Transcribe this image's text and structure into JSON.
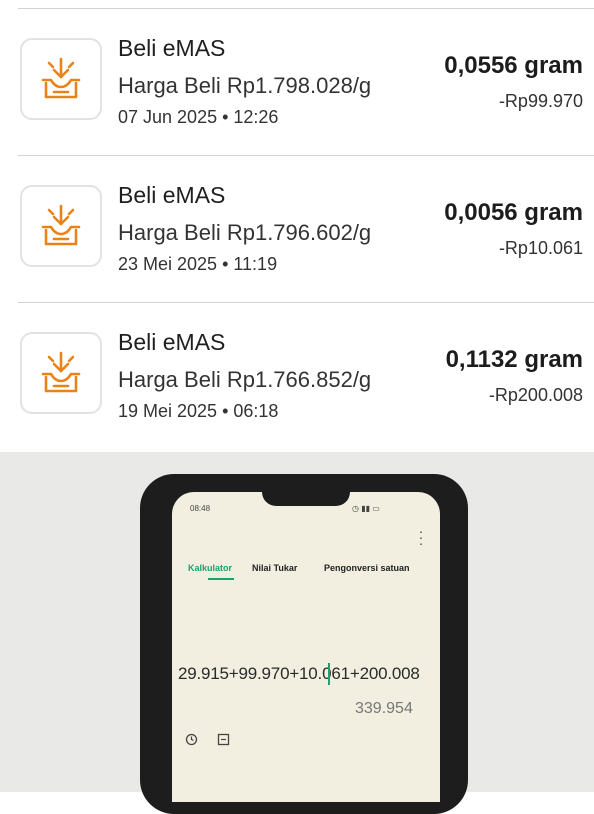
{
  "transactions": [
    {
      "title": "Beli eMAS",
      "price": "Harga Beli Rp1.798.028/g",
      "date": "07 Jun 2025 • 12:26",
      "gram": "0,0556 gram",
      "amount": "-Rp99.970",
      "icon": "gold-purchase-icon"
    },
    {
      "title": "Beli eMAS",
      "price": "Harga Beli Rp1.796.602/g",
      "date": "23 Mei 2025 • 11:19",
      "gram": "0,0056 gram",
      "amount": "-Rp10.061",
      "icon": "gold-purchase-icon"
    },
    {
      "title": "Beli eMAS",
      "price": "Harga Beli Rp1.766.852/g",
      "date": "19 Mei 2025 • 06:18",
      "gram": "0,1132 gram",
      "amount": "-Rp200.008",
      "icon": "gold-purchase-icon"
    }
  ],
  "colors": {
    "icon_orange": "#e8831a",
    "calculator_accent": "#18a36e"
  },
  "calculator_photo": {
    "status_time": "08:48",
    "tabs": [
      "Kalkulator",
      "Nilai Tukar",
      "Pengonversi satuan"
    ],
    "active_tab": "Kalkulator",
    "expression": "29.915+99.970+10.061+200.008",
    "result": "339.954",
    "icons": [
      "history-icon",
      "unit-converter-icon",
      "more-menu-icon"
    ]
  }
}
